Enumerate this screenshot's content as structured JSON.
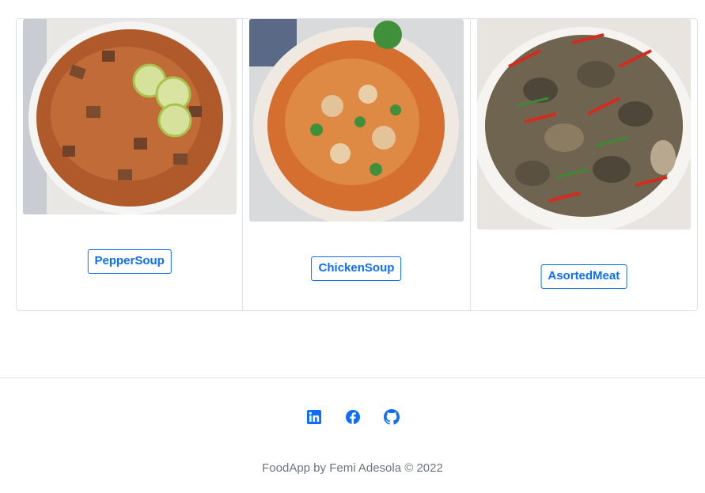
{
  "meals": [
    {
      "name": "PepperSoup",
      "image": "pepper-soup-photo"
    },
    {
      "name": "ChickenSoup",
      "image": "chicken-soup-photo"
    },
    {
      "name": "AsortedMeat",
      "image": "assorted-meat-photo"
    }
  ],
  "social": {
    "linkedin_icon": "linkedin-icon",
    "facebook_icon": "facebook-icon",
    "github_icon": "github-icon"
  },
  "footer": {
    "text": "FoodApp by Femi Adesola © 2022"
  },
  "colors": {
    "primary": "#0d6efd",
    "border": "#dee2e6",
    "muted": "#6c757d"
  }
}
